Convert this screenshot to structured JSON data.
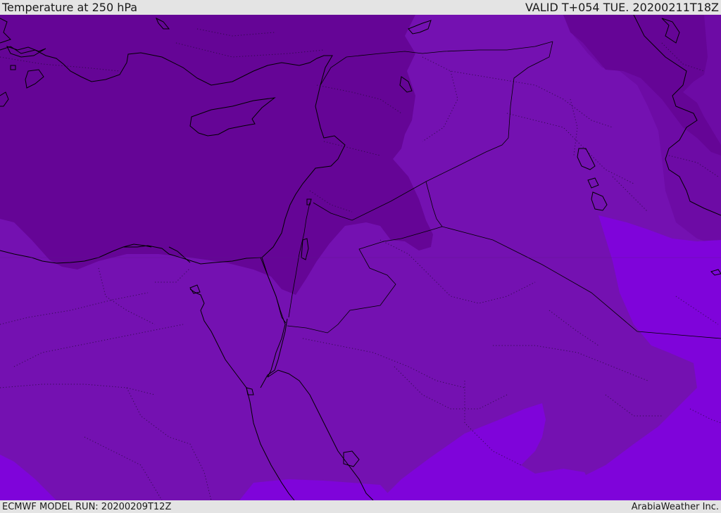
{
  "header": {
    "title": "Temperature at 250 hPa",
    "valid_time": "VALID T+054 TUE. 20200211T18Z"
  },
  "footer": {
    "model_run": "ECMWF MODEL RUN: 20200209T12Z",
    "credit": "ArabiaWeather Inc."
  },
  "map": {
    "field": "temperature",
    "level_hpa": 250,
    "colors": {
      "coldest_zone": "#650596",
      "mid_zone": "#7411B1",
      "mid_zone_east": "#6D0BA5",
      "warm_zone": "#7F04DA",
      "lines": "#000000"
    }
  }
}
